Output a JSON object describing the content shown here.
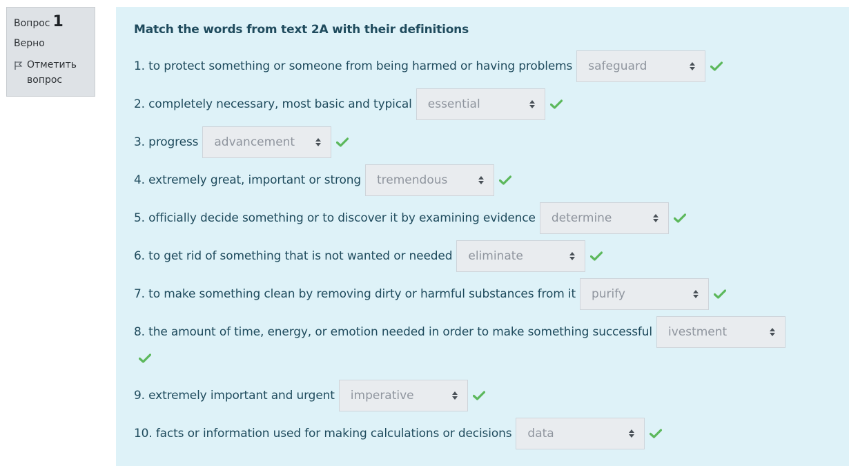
{
  "info": {
    "question_label": "Вопрос",
    "question_number": "1",
    "state": "Верно",
    "flag_label": "Отметить вопрос"
  },
  "question": {
    "text": "Match the words from text 2A with their definitions",
    "rows": [
      {
        "stem": "1. to protect something or someone from being harmed or having problems",
        "answer": "safeguard",
        "status": "correct"
      },
      {
        "stem": "2. completely necessary, most basic and typical",
        "answer": "essential",
        "status": "correct"
      },
      {
        "stem": "3. progress",
        "answer": "advancement",
        "status": "correct"
      },
      {
        "stem": "4. extremely great, important or strong",
        "answer": "tremendous",
        "status": "correct"
      },
      {
        "stem": "5. officially decide something or to discover it by examining evidence",
        "answer": "determine",
        "status": "correct"
      },
      {
        "stem": "6. to get rid of something that is not wanted or needed",
        "answer": "eliminate",
        "status": "correct"
      },
      {
        "stem": "7. to make something clean by removing dirty or harmful substances from it",
        "answer": "purify",
        "status": "correct"
      },
      {
        "stem": "8. the amount of time, energy, or emotion needed in order to make something successful",
        "answer": "ivestment",
        "status": "correct"
      },
      {
        "stem": "9. extremely important and urgent",
        "answer": "imperative",
        "status": "correct"
      },
      {
        "stem": "10. facts or information used for making calculations or decisions",
        "answer": "data",
        "status": "correct"
      }
    ]
  },
  "colors": {
    "info_bg": "#dee2e6",
    "content_bg": "#def2f8",
    "text": "#1f4b5d",
    "select_bg": "#e9ecef",
    "select_text": "#8f959e",
    "correct": "#5cb85c"
  },
  "icons": {
    "flag": "flag-icon",
    "correct": "check-icon",
    "select_arrows": "updown-arrows-icon"
  }
}
